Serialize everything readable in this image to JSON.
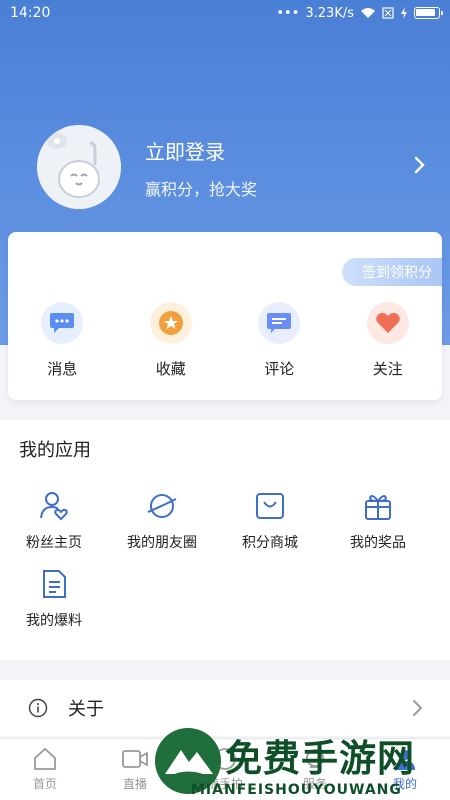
{
  "status": {
    "time": "14:20",
    "dots": "•••",
    "speed": "3.23K/s"
  },
  "profile": {
    "title": "立即登录",
    "subtitle": "赢积分，抢大奖"
  },
  "signin_label": "签到领积分",
  "quick_actions": [
    {
      "label": "消息",
      "icon": "message-icon",
      "color": "#5b8ef0"
    },
    {
      "label": "收藏",
      "icon": "star-icon",
      "color": "#f2a03d"
    },
    {
      "label": "评论",
      "icon": "comment-icon",
      "color": "#6b8ef5"
    },
    {
      "label": "关注",
      "icon": "heart-icon",
      "color": "#ef6f55"
    }
  ],
  "apps": {
    "title": "我的应用",
    "items": [
      {
        "label": "粉丝主页",
        "icon": "fan-page-icon"
      },
      {
        "label": "我的朋友圈",
        "icon": "planet-icon"
      },
      {
        "label": "积分商城",
        "icon": "shopping-bag-icon"
      },
      {
        "label": "我的奖品",
        "icon": "gift-icon"
      },
      {
        "label": "我的爆料",
        "icon": "document-icon"
      }
    ]
  },
  "about": {
    "label": "关于"
  },
  "tabs": [
    {
      "label": "首页",
      "icon": "home-icon"
    },
    {
      "label": "直播",
      "icon": "video-icon"
    },
    {
      "label": "随手拍",
      "icon": "camera-icon"
    },
    {
      "label": "服务",
      "icon": "service-icon"
    },
    {
      "label": "我的",
      "icon": "user-icon",
      "active": true
    }
  ],
  "watermark": {
    "text": "免费手游网",
    "sub": "MIANFEISHOUYOUWANG"
  },
  "colors": {
    "accent": "#4a7fd6",
    "active_tab": "#3b6fd1"
  }
}
